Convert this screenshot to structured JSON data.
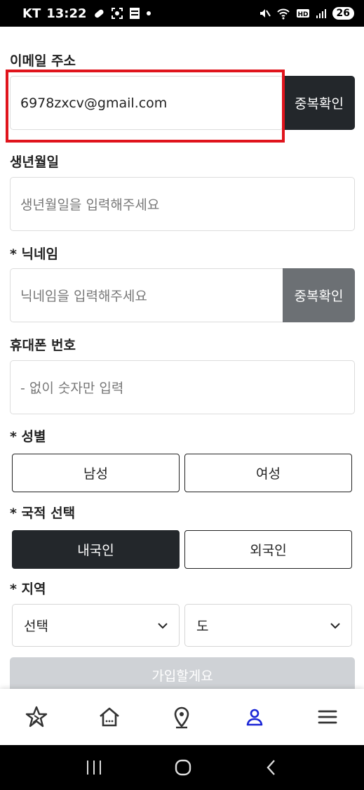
{
  "status_bar": {
    "carrier": "KT",
    "time": "13:22",
    "battery": "26"
  },
  "form": {
    "email": {
      "label": "이메일 주소",
      "value": "6978zxcv@gmail.com",
      "check_button": "중복확인"
    },
    "birth": {
      "label": "생년월일",
      "placeholder": "생년월일을 입력해주세요"
    },
    "nickname": {
      "label": "* 닉네임",
      "placeholder": "닉네임을 입력해주세요",
      "check_button": "중복확인"
    },
    "phone": {
      "label": "휴대폰 번호",
      "placeholder": "- 없이 숫자만 입력"
    },
    "gender": {
      "label": "* 성별",
      "options": [
        "남성",
        "여성"
      ]
    },
    "nationality": {
      "label": "* 국적 선택",
      "options": [
        "내국인",
        "외국인"
      ],
      "selected": "내국인"
    },
    "region": {
      "label": "* 지역",
      "select1": "선택",
      "select2": "도"
    },
    "submit": "가입할게요"
  },
  "bottom_nav": [
    "star-logo",
    "home",
    "location",
    "profile",
    "menu"
  ],
  "colors": {
    "dark": "#23272b",
    "gray_button": "#6c7074",
    "highlight": "#e0141c",
    "active_nav": "#1a25d6",
    "submit_disabled": "#cfd2d6"
  }
}
